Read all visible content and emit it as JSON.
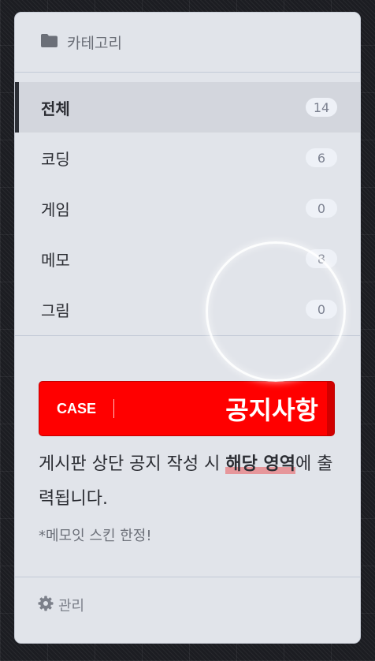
{
  "header": {
    "title": "카테고리",
    "icon": "folder-icon"
  },
  "categories": [
    {
      "name": "전체",
      "count": "14",
      "active": true
    },
    {
      "name": "코딩",
      "count": "6"
    },
    {
      "name": "게임",
      "count": "0"
    },
    {
      "name": "메모",
      "count": "8"
    },
    {
      "name": "그림",
      "count": "0"
    }
  ],
  "notice": {
    "case_label": "CASE",
    "title": "공지사항",
    "desc_before": "게시판 상단 공지 작성 시 ",
    "desc_highlight": "해당 영역",
    "desc_after": "에 출력됩니다.",
    "note": "*메모잇 스킨 한정!",
    "banner_color": "#ff0000",
    "highlight_color": "#e77c80"
  },
  "footer": {
    "label": "관리",
    "icon": "gear-icon"
  }
}
